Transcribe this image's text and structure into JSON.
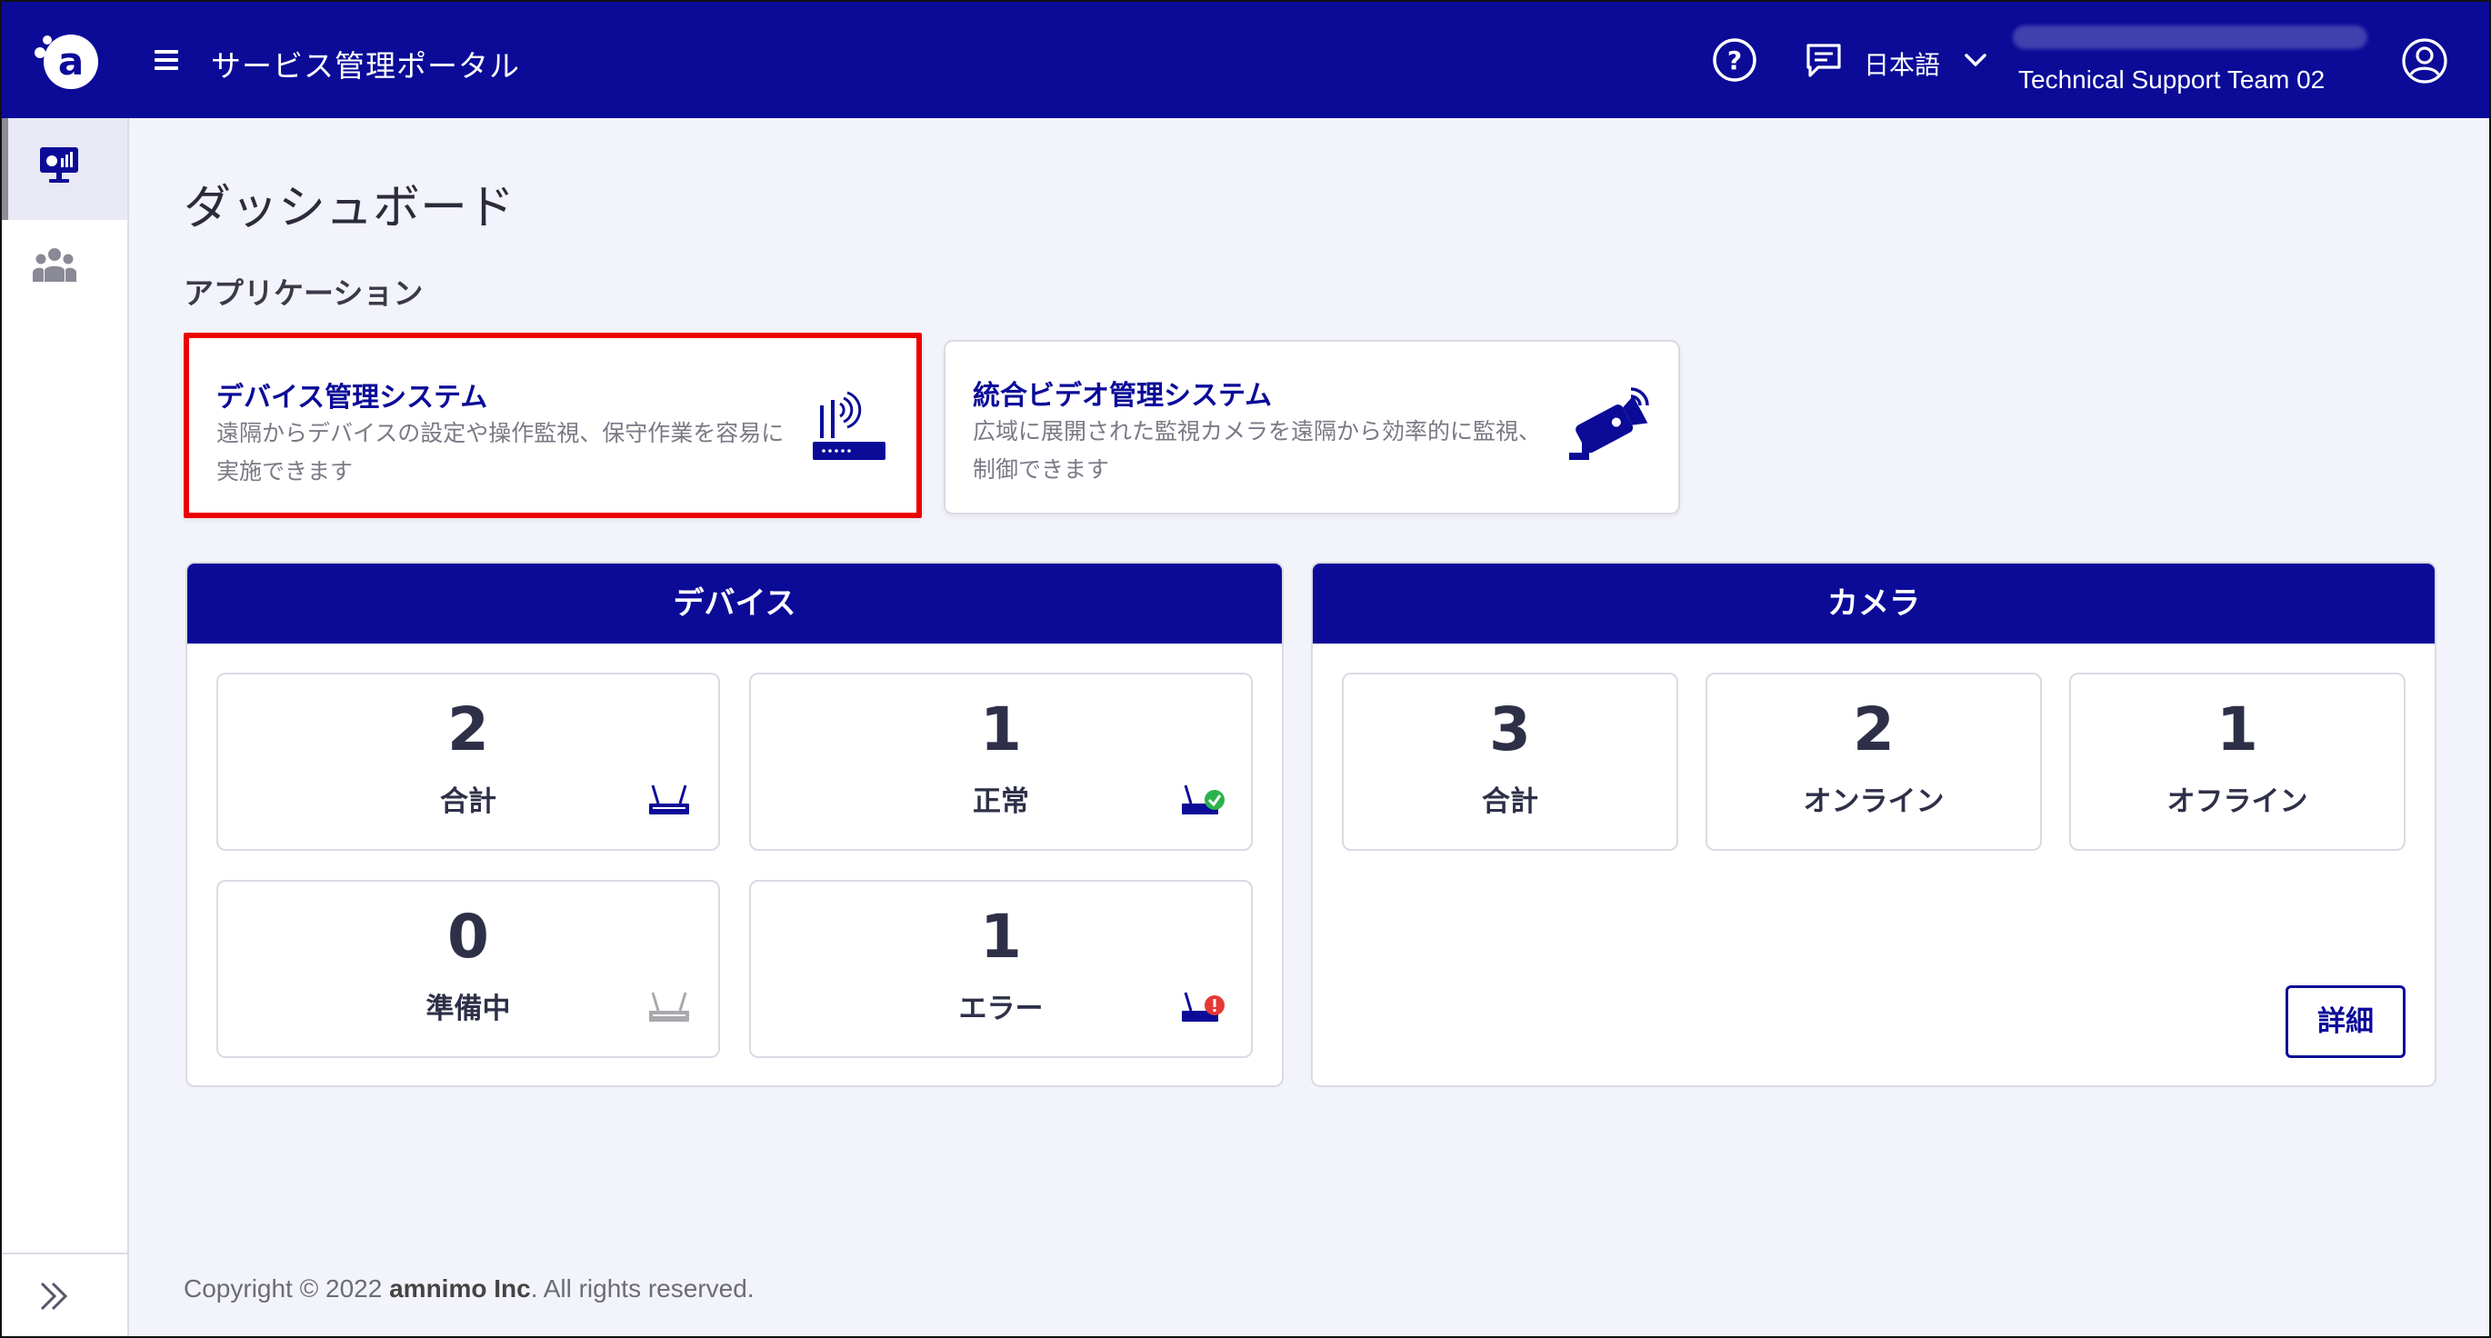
{
  "header": {
    "portal_title": "サービス管理ポータル",
    "language": "日本語",
    "user_team": "Technical Support Team 02"
  },
  "page": {
    "title": "ダッシュボード",
    "apps_heading": "アプリケーション"
  },
  "apps": [
    {
      "name": "デバイス管理システム",
      "description": "遠隔からデバイスの設定や操作監視、保守作業を容易に実施できます",
      "icon": "router-icon"
    },
    {
      "name": "統合ビデオ管理システム",
      "description": "広域に展開された監視カメラを遠隔から効率的に監視、制御できます",
      "icon": "security-camera-icon"
    }
  ],
  "device_panel": {
    "title": "デバイス",
    "stats": [
      {
        "value": "2",
        "label": "合計",
        "icon": "router-icon"
      },
      {
        "value": "1",
        "label": "正常",
        "icon": "router-ok-icon"
      },
      {
        "value": "0",
        "label": "準備中",
        "icon": "router-pending-icon"
      },
      {
        "value": "1",
        "label": "エラー",
        "icon": "router-error-icon"
      }
    ]
  },
  "camera_panel": {
    "title": "カメラ",
    "stats": [
      {
        "value": "3",
        "label": "合計"
      },
      {
        "value": "2",
        "label": "オンライン"
      },
      {
        "value": "1",
        "label": "オフライン"
      }
    ],
    "details_label": "詳細"
  },
  "footer": {
    "prefix": "Copyright © 2022 ",
    "company": "amnimo Inc",
    "suffix": ". All rights reserved."
  },
  "colors": {
    "brand": "#0b0b98",
    "highlight": "#ee0000",
    "ok": "#2bb24c",
    "error": "#e53935"
  }
}
